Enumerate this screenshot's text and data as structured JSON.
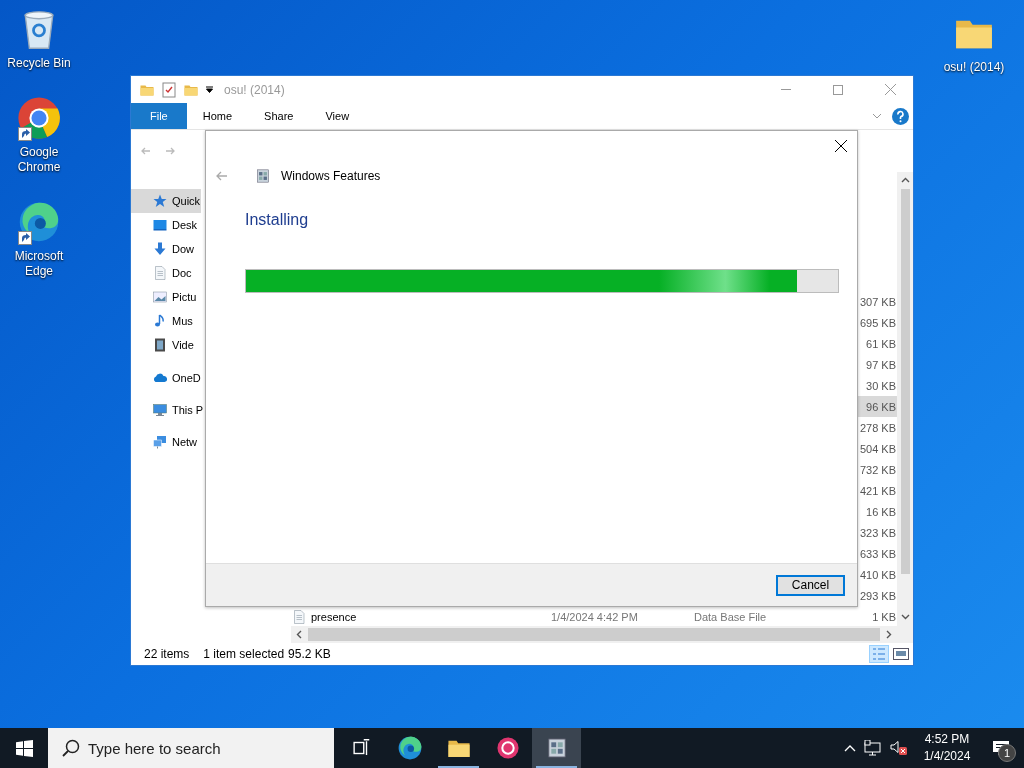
{
  "desktop_icons": [
    {
      "label": "Recycle Bin",
      "kind": "recycle",
      "shortcut": false
    },
    {
      "label": "Google Chrome",
      "kind": "chrome",
      "shortcut": true
    },
    {
      "label": "Microsoft Edge",
      "kind": "edge",
      "shortcut": true
    },
    {
      "label": "osu! (2014)",
      "kind": "folder",
      "shortcut": false
    }
  ],
  "explorer": {
    "title": "osu! (2014)",
    "ribbon_tabs": [
      {
        "label": "File",
        "selected": true
      },
      {
        "label": "Home",
        "selected": false
      },
      {
        "label": "Share",
        "selected": false
      },
      {
        "label": "View",
        "selected": false
      }
    ],
    "nav_items": [
      {
        "label": "Quick",
        "kind": "star",
        "selected": true
      },
      {
        "label": "Desk",
        "kind": "desktop",
        "selected": false
      },
      {
        "label": "Dow",
        "kind": "download",
        "selected": false
      },
      {
        "label": "Doc",
        "kind": "document",
        "selected": false
      },
      {
        "label": "Pictu",
        "kind": "picture",
        "selected": false
      },
      {
        "label": "Mus",
        "kind": "music",
        "selected": false
      },
      {
        "label": "Vide",
        "kind": "video",
        "selected": false
      },
      {
        "label": "OneD",
        "kind": "cloud",
        "selected": false
      },
      {
        "label": "This P",
        "kind": "pc",
        "selected": false
      },
      {
        "label": "Netw",
        "kind": "network",
        "selected": false
      }
    ],
    "files": [
      {
        "size": "307 KB",
        "selected": false
      },
      {
        "size": "695 KB",
        "selected": false
      },
      {
        "size": "61 KB",
        "selected": false
      },
      {
        "size": "97 KB",
        "selected": false
      },
      {
        "size": "30 KB",
        "selected": false
      },
      {
        "size": "96 KB",
        "selected": true
      },
      {
        "size": "278 KB",
        "selected": false
      },
      {
        "size": "504 KB",
        "selected": false
      },
      {
        "size": "732 KB",
        "selected": false
      },
      {
        "size": "421 KB",
        "selected": false
      },
      {
        "size": "16 KB",
        "selected": false
      },
      {
        "size": "323 KB",
        "selected": false
      },
      {
        "size": "633 KB",
        "selected": false
      },
      {
        "size": "410 KB",
        "selected": false
      },
      {
        "size": "293 KB",
        "selected": false
      },
      {
        "name": "presence",
        "date": "1/4/2024 4:42 PM",
        "type": "Data Base File",
        "size": "1 KB",
        "selected": false
      }
    ],
    "status": {
      "count": "22 items",
      "selection": "1 item selected",
      "size": "95.2 KB"
    }
  },
  "dialog": {
    "title": "Windows Features",
    "heading": "Installing",
    "progress": {
      "level": 0.93
    },
    "button": "Cancel"
  },
  "taskbar": {
    "search": {
      "placeholder": "Type here to search"
    },
    "apps": [
      {
        "kind": "taskview",
        "running": false,
        "active": false
      },
      {
        "kind": "edge",
        "running": false,
        "active": false
      },
      {
        "kind": "folder",
        "running": true,
        "active": false
      },
      {
        "kind": "osu",
        "running": false,
        "active": false
      },
      {
        "kind": "features",
        "running": true,
        "active": true
      }
    ],
    "clock": {
      "time": "4:52 PM",
      "date": "1/4/2024"
    },
    "notifications": "1"
  }
}
